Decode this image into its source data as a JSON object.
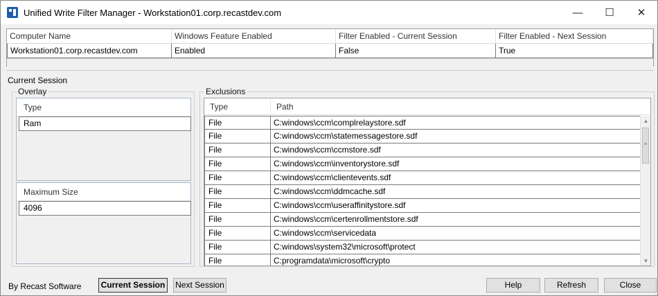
{
  "window": {
    "title": "Unified Write Filter Manager - Workstation01.corp.recastdev.com",
    "minimize_glyph": "—",
    "maximize_glyph": "☐",
    "close_glyph": "✕"
  },
  "computers_table": {
    "headers": [
      "Computer Name",
      "Windows Feature Enabled",
      "Filter Enabled - Current Session",
      "Filter Enabled - Next Session"
    ],
    "rows": [
      [
        "Workstation01.corp.recastdev.com",
        "Enabled",
        "False",
        "True"
      ]
    ]
  },
  "current_session": {
    "label": "Current Session",
    "overlay": {
      "label": "Overlay",
      "type_header": "Type",
      "type_value": "Ram",
      "max_size_header": "Maximum Size",
      "max_size_value": "4096"
    },
    "exclusions": {
      "label": "Exclusions",
      "headers": [
        "Type",
        "Path"
      ],
      "rows": [
        [
          "File",
          "C:windows\\ccm\\complrelaystore.sdf"
        ],
        [
          "File",
          "C:windows\\ccm\\statemessagestore.sdf"
        ],
        [
          "File",
          "C:windows\\ccm\\ccmstore.sdf"
        ],
        [
          "File",
          "C:windows\\ccm\\inventorystore.sdf"
        ],
        [
          "File",
          "C:windows\\ccm\\clientevents.sdf"
        ],
        [
          "File",
          "C:windows\\ccm\\ddmcache.sdf"
        ],
        [
          "File",
          "C:windows\\ccm\\useraffinitystore.sdf"
        ],
        [
          "File",
          "C:windows\\ccm\\certenrollmentstore.sdf"
        ],
        [
          "File",
          "C:windows\\ccm\\servicedata"
        ],
        [
          "File",
          "C:windows\\system32\\microsoft\\protect"
        ],
        [
          "File",
          "C:programdata\\microsoft\\crypto"
        ]
      ]
    }
  },
  "footer": {
    "brand": "By Recast Software",
    "current_session_button": "Current Session",
    "next_session_button": "Next Session",
    "help_button": "Help",
    "refresh_button": "Refresh",
    "close_button": "Close"
  }
}
